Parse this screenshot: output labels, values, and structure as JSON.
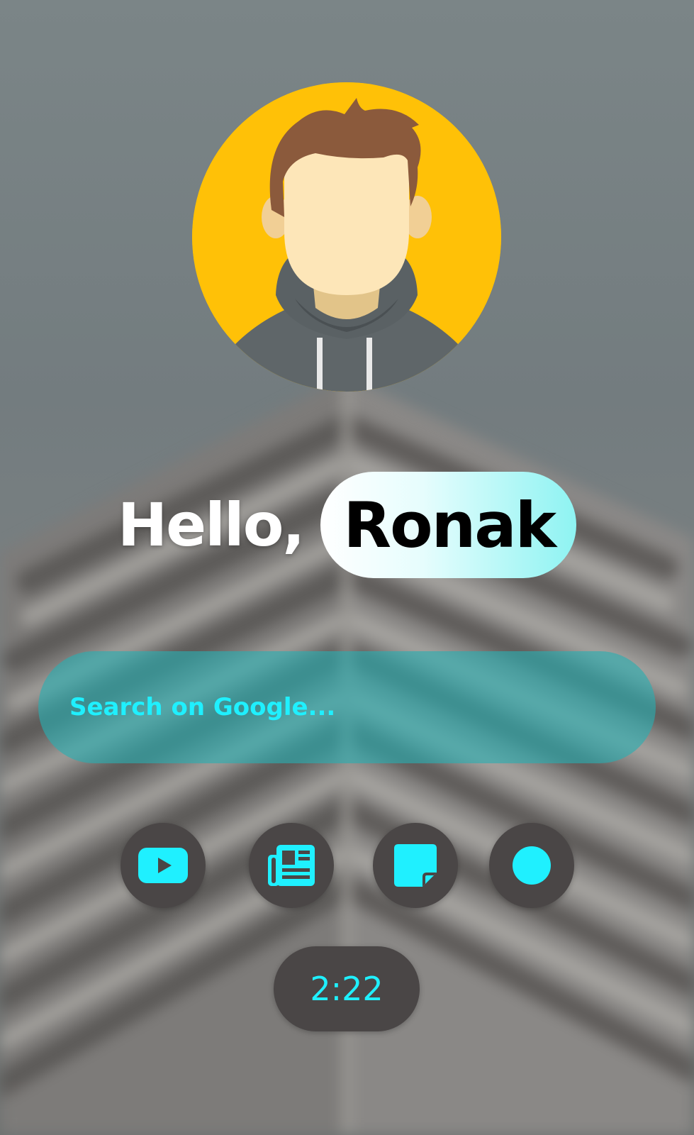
{
  "greeting": {
    "hello": "Hello,",
    "name": "Ronak"
  },
  "search": {
    "placeholder": "Search on Google..."
  },
  "dock": {
    "items": [
      {
        "name": "youtube",
        "icon": "youtube-icon"
      },
      {
        "name": "news",
        "icon": "newspaper-icon"
      },
      {
        "name": "notes",
        "icon": "sticky-note-icon"
      },
      {
        "name": "record",
        "icon": "circle-icon"
      }
    ]
  },
  "clock": {
    "time": "2:22"
  },
  "colors": {
    "accent": "#1ff0ff",
    "avatar_bg": "#ffc107",
    "button_bg": "#4a4646",
    "search_bg": "#28afb2"
  }
}
